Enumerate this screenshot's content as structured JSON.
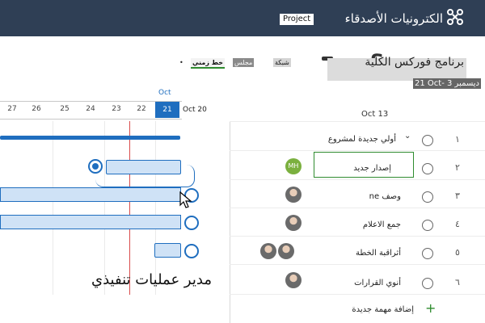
{
  "topbar": {
    "app_name": "الكترونيات الأصدقاء",
    "project_label": "Project",
    "icon": "app-launcher-icon"
  },
  "plan": {
    "title": "برنامج فوركس الكلية",
    "date_range": "21 Oct- 3 ديسمبر"
  },
  "tabs": [
    {
      "label": "خط زمني"
    },
    {
      "label": "مجلس"
    },
    {
      "label": "شبكة"
    }
  ],
  "timeline": {
    "month_label": "Oct",
    "ticks": [
      "27",
      "26",
      "25",
      "24",
      "23",
      "22",
      "21"
    ],
    "today_tick": "21",
    "header_date": "Oct 20",
    "caption": "مدير عمليات تنفيذي"
  },
  "grid": {
    "date_column": "Oct 13",
    "rows": [
      {
        "num": "١",
        "name": "أولي جديدة لمشروع"
      },
      {
        "num": "٢",
        "name": "إصدار جديد",
        "avatar": "MH"
      },
      {
        "num": "٣",
        "name": "وصف ne"
      },
      {
        "num": "٤",
        "name": "جمع الاعلام"
      },
      {
        "num": "٥",
        "name": "أثراقبة الخطة"
      },
      {
        "num": "٦",
        "name": "أنوي القرارات"
      }
    ],
    "add_task": "إضافة مهمة جديدة"
  },
  "colors": {
    "topbar": "#2f3f55",
    "accent_blue": "#1f6ebf",
    "today_line": "#d94c4c",
    "accent_green": "#2f8c2f"
  }
}
